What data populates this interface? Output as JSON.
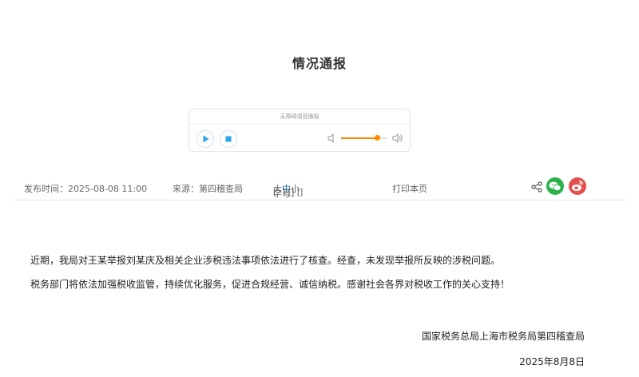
{
  "article": {
    "title": "情况通报",
    "paragraphs": [
      "近期，我局对王某举报刘某庆及相关企业涉税违法事项依法进行了核查。经查，未发现举报所反映的涉税问题。",
      "税务部门将依法加强税收监管，持续优化服务，促进合规经营、诚信纳税。感谢社会各界对税收工作的关心支持！"
    ],
    "signature": "国家税务总局上海市税务局第四稽查局",
    "signature_date": "2025年8月8日"
  },
  "player": {
    "caption": "无障碍语音播报",
    "volume_level": 0.78,
    "icons": {
      "play": "play-icon",
      "stop": "stop-icon",
      "volume_low": "volume-low-icon",
      "volume_high": "volume-high-icon"
    },
    "colors": {
      "accent": "#ff8a00",
      "button": "#2aa5e8"
    }
  },
  "meta": {
    "publish_time": "发布时间：2025-08-08 11:00",
    "source": "来源：第四稽查局",
    "font_size_label": "字号：",
    "font_sizes": [
      "大",
      "中",
      "小"
    ],
    "active_size": "中",
    "print_label": "打印本页",
    "share_icons": [
      "share-icon",
      "wechat-icon",
      "weibo-icon"
    ],
    "colors": {
      "wechat": "#2bb34a",
      "weibo": "#e54e4e",
      "active_size": "#1f6fb3"
    }
  }
}
